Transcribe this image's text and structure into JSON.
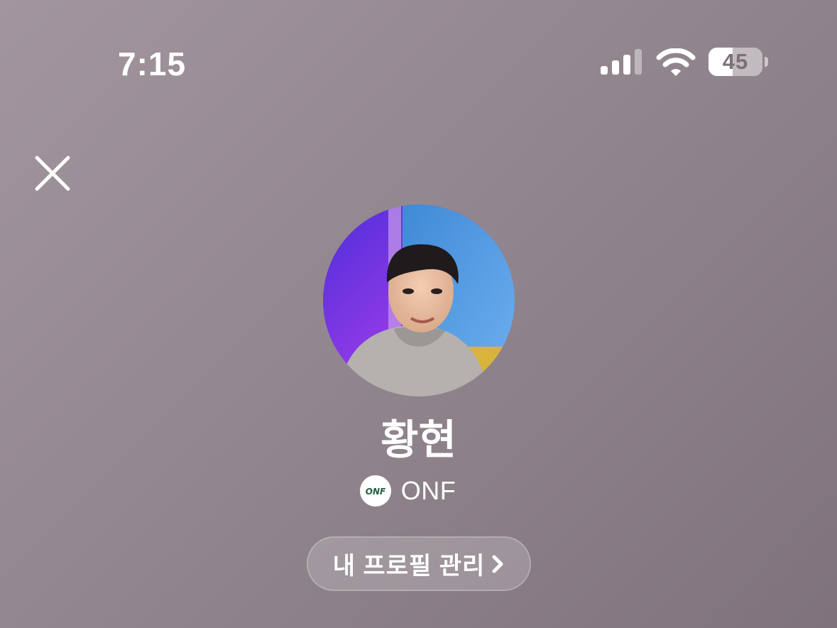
{
  "status_bar": {
    "time": "7:15",
    "battery_level": "45",
    "battery_fraction": 0.45
  },
  "icons": {
    "close": "close-icon",
    "signal": "signal-icon",
    "wifi": "wifi-icon",
    "battery": "battery-icon",
    "chevron": "chevron-right-icon"
  },
  "profile": {
    "name": "황현",
    "group_logo_text": "ONF",
    "group_name": "ONF",
    "manage_label": "내 프로필 관리"
  },
  "colors": {
    "background_top": "#a2959e",
    "background_bottom": "#7f727c",
    "logo_green": "#1f5e3d"
  }
}
